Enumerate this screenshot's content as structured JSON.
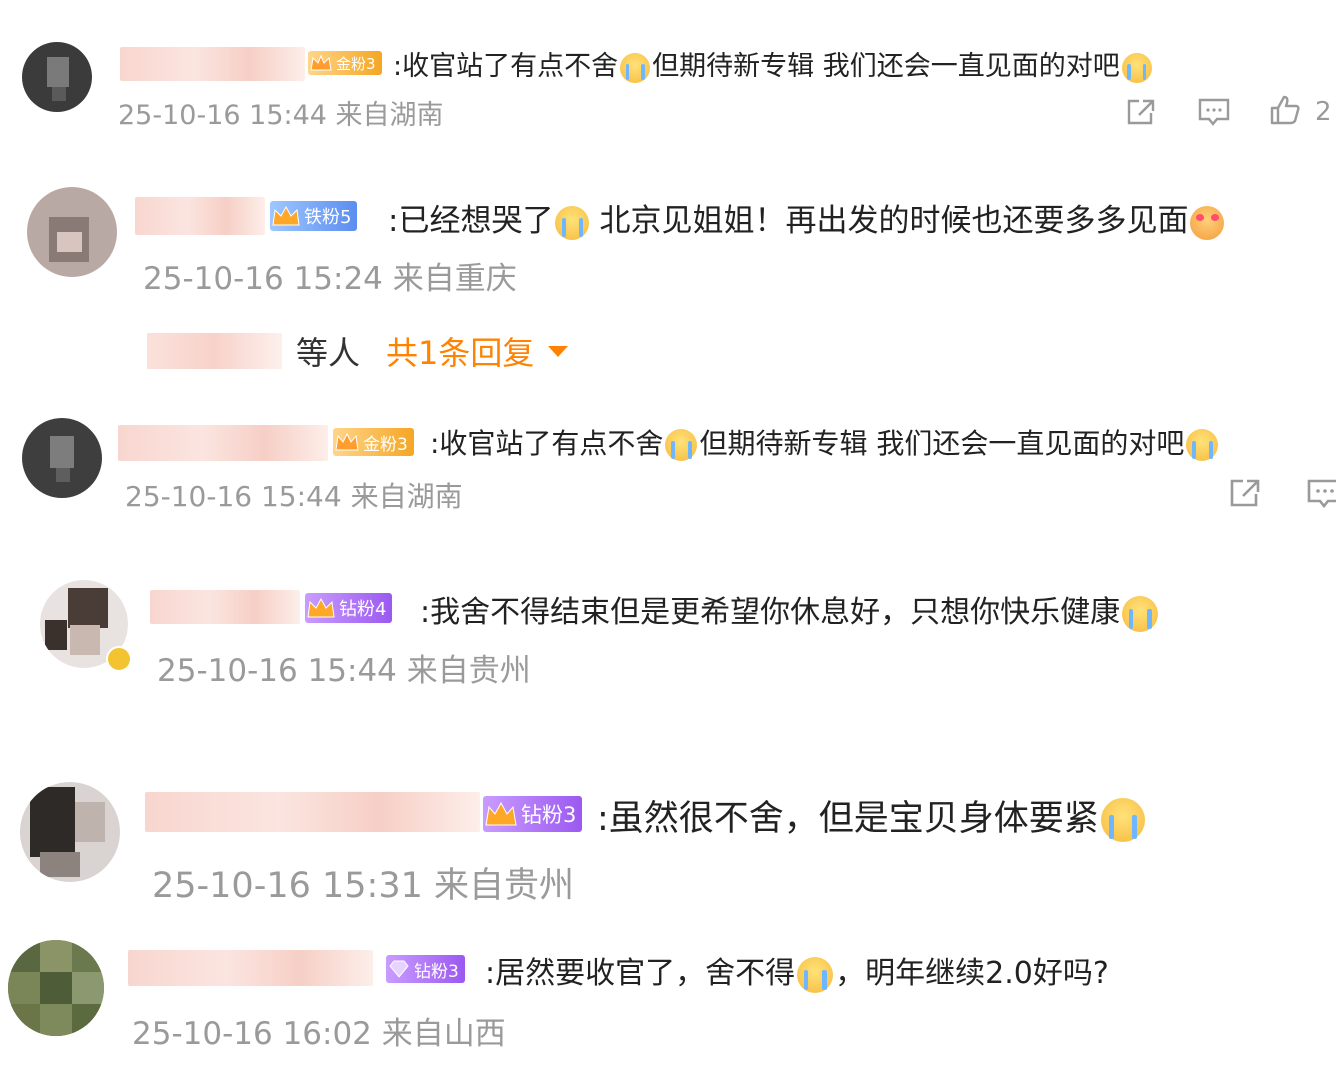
{
  "comments": [
    {
      "badge": "金粉3",
      "text_a": ":收官站了有点不舍",
      "text_b": "但期待新专辑 我们还会一直见面的对吧",
      "time": "25-10-16 15:44",
      "location": "来自湖南",
      "like_count": "2"
    },
    {
      "badge": "铁粉5",
      "text_a": ":已经想哭了",
      "text_b": "北京见姐姐！再出发的时候也还要多多见面",
      "time": "25-10-16 15:24",
      "location": "来自重庆",
      "reply_who": "等人",
      "reply_count": "共1条回复"
    },
    {
      "badge": "金粉3",
      "text_a": ":收官站了有点不舍",
      "text_b": "但期待新专辑 我们还会一直见面的对吧",
      "time": "25-10-16 15:44",
      "location": "来自湖南"
    },
    {
      "badge": "钻粉4",
      "text_a": ":我舍不得结束但是更希望你休息好，只想你快乐健康",
      "time": "25-10-16 15:44",
      "location": "来自贵州"
    },
    {
      "badge": "钻粉3",
      "text_a": ":虽然很不舍，但是宝贝身体要紧",
      "time": "25-10-16 15:31",
      "location": "来自贵州"
    },
    {
      "badge": "钻粉3",
      "text_a": ":居然要收官了，舍不得",
      "text_b": "，明年继续2.0好吗?",
      "time": "25-10-16 16:02",
      "location": "来自山西"
    }
  ],
  "icons": {
    "share": "share-icon",
    "comment": "comment-icon",
    "like": "thumbs-up-icon",
    "crown": "crown-icon",
    "verified": "verified-icon"
  },
  "colors": {
    "accent": "#ff8200",
    "meta": "#9a9a9a",
    "gold_badge": "#f5a623",
    "iron_badge": "#5b8def",
    "diamond_badge": "#9b59f0"
  }
}
